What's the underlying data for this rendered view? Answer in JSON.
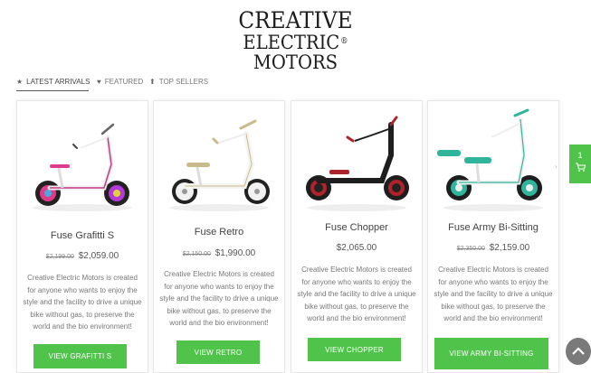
{
  "brand": {
    "line1": "CREATIVE",
    "line2": "ELECTRIC",
    "reg": "®",
    "line3": "MOTORS"
  },
  "tabs": [
    {
      "label": "LATEST ARRIVALS",
      "icon": "star-icon"
    },
    {
      "label": "FEATURED",
      "icon": "heart-icon"
    },
    {
      "label": "TOP SELLERS",
      "icon": "arrow-up-icon"
    }
  ],
  "products": [
    {
      "name": "Fuse Grafitti S",
      "old_price": "$2,199.00",
      "price": "$2,059.00",
      "description": "Creative Electric Motors is created for anyone who wants to enjoy the style and the facility to drive a unique bike without gas, to preserve the world and the bio environment!",
      "button": "VIEW GRAFITTI S",
      "color": "#e23a8a"
    },
    {
      "name": "Fuse Retro",
      "old_price": "$2,150.00",
      "price": "$1,990.00",
      "description": "Creative Electric Motors is created for anyone who wants to enjoy the style and the facility to drive a unique bike without gas, to preserve the world and the bio environment!",
      "button": "VIEW RETRO",
      "color": "#c9b98c"
    },
    {
      "name": "Fuse Chopper",
      "old_price": "",
      "price": "$2,065.00",
      "description": "Creative Electric Motors is created for anyone who wants to enjoy the style and the facility to drive a unique bike without gas, to preserve the world and the bio environment!",
      "button": "VIEW CHOPPER",
      "color": "#b0232a"
    },
    {
      "name": "Fuse Army Bi-Sitting",
      "old_price": "$2,350.00",
      "price": "$2,159.00",
      "description": "Creative Electric Motors is created for anyone who wants to enjoy the style and the facility to drive a unique bike without gas, to preserve the world and the bio environment!",
      "button": "VIEW ARMY BI-SITTING",
      "color": "#2fb59c"
    }
  ],
  "cart": {
    "count": "1",
    "icon": "cart-icon"
  },
  "scroll_top": {
    "icon": "chevron-up-icon"
  },
  "accent": "#4fc34a"
}
